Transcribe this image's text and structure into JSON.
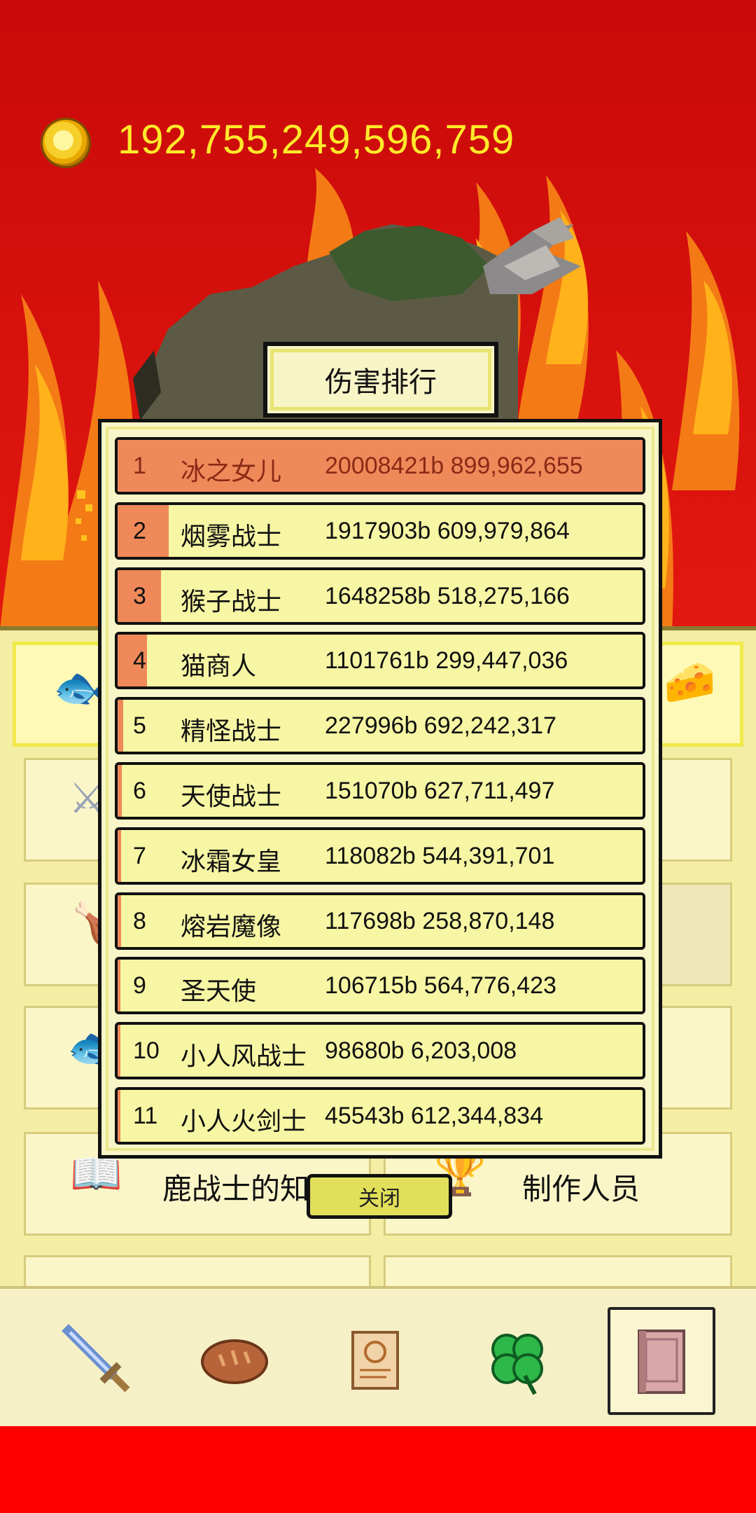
{
  "currency": {
    "amount": "192,755,249,596,759",
    "icon": "gold-coin-icon"
  },
  "dialog": {
    "title": "伤害排行",
    "close_label": "关闭",
    "rows": [
      {
        "rank": "1",
        "name": "冰之女儿",
        "damage": "20008421b 899,962,655",
        "share": 1.0
      },
      {
        "rank": "2",
        "name": "烟雾战士",
        "damage": "1917903b 609,979,864",
        "share": 0.096
      },
      {
        "rank": "3",
        "name": "猴子战士",
        "damage": "1648258b 518,275,166",
        "share": 0.082
      },
      {
        "rank": "4",
        "name": "猫商人",
        "damage": "1101761b 299,447,036",
        "share": 0.055
      },
      {
        "rank": "5",
        "name": "精怪战士",
        "damage": "227996b 692,242,317",
        "share": 0.011
      },
      {
        "rank": "6",
        "name": "天使战士",
        "damage": "151070b 627,711,497",
        "share": 0.008
      },
      {
        "rank": "7",
        "name": "冰霜女皇",
        "damage": "118082b 544,391,701",
        "share": 0.006
      },
      {
        "rank": "8",
        "name": "熔岩魔像",
        "damage": "117698b 258,870,148",
        "share": 0.006
      },
      {
        "rank": "9",
        "name": "圣天使",
        "damage": "106715b 564,776,423",
        "share": 0.005
      },
      {
        "rank": "10",
        "name": "小人风战士",
        "damage": "98680b 6,203,008",
        "share": 0.005
      },
      {
        "rank": "11",
        "name": "小人火剑士",
        "damage": "45543b 612,344,834",
        "share": 0.002
      }
    ]
  },
  "background_panel": {
    "knowledge_label": "鹿战士的知识",
    "credits_label": "制作人员"
  },
  "tabs": [
    {
      "icon": "sword-icon"
    },
    {
      "icon": "bread-icon"
    },
    {
      "icon": "scroll-icon"
    },
    {
      "icon": "clover-icon"
    },
    {
      "icon": "book-icon",
      "active": true
    }
  ],
  "colors": {
    "bar": "#f0895a",
    "row": "#f6f6a4",
    "coin_text": "#ffea2a",
    "background": "#e01010"
  }
}
